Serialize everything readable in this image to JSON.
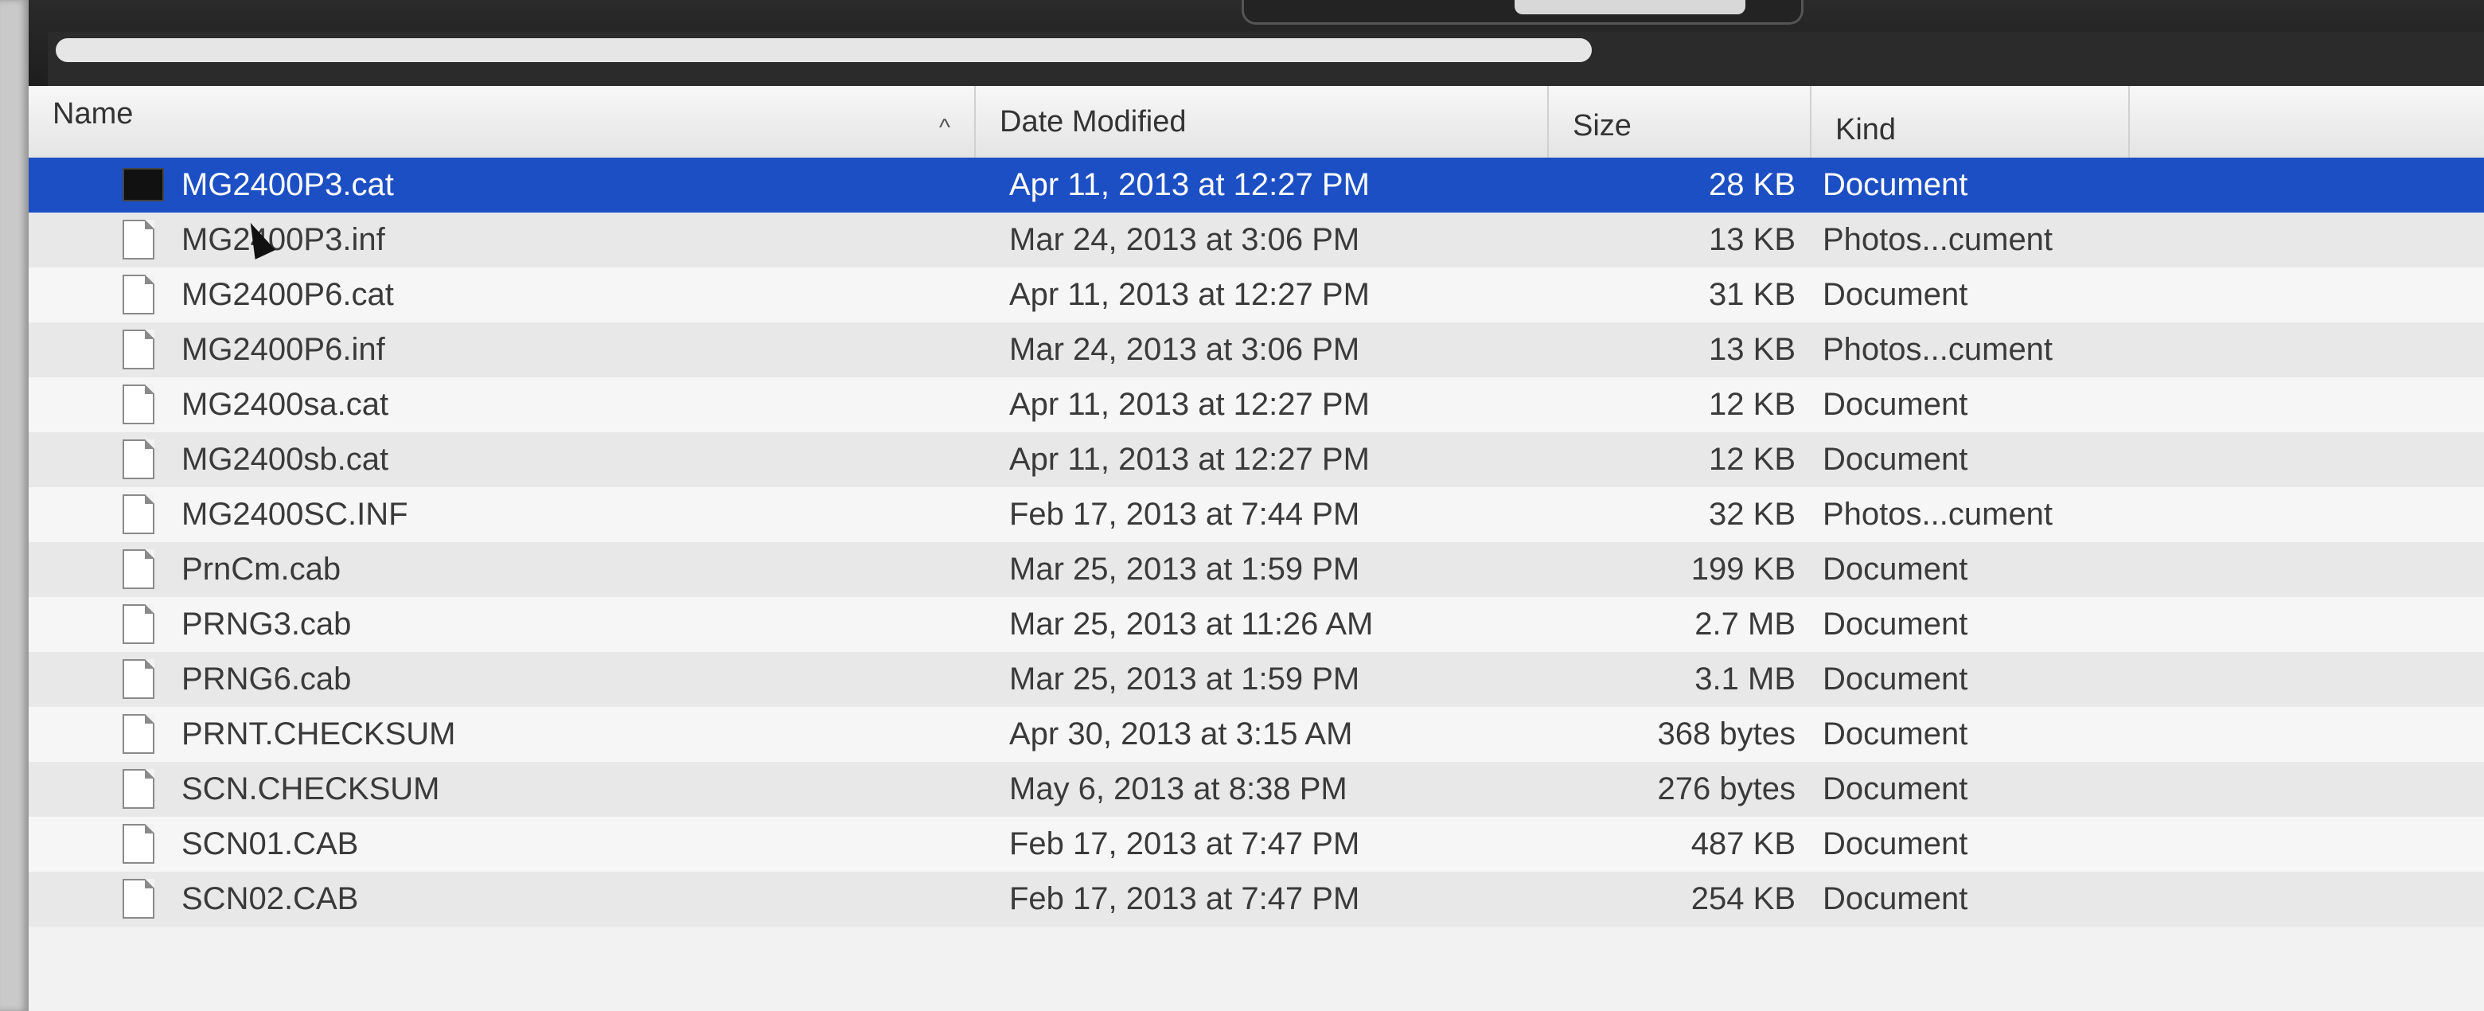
{
  "columns": {
    "name": "Name",
    "date": "Date Modified",
    "size": "Size",
    "kind": "Kind"
  },
  "sort": {
    "column": "name",
    "direction": "ascending",
    "icon": "chevron-up-icon"
  },
  "selected_index": 0,
  "files": [
    {
      "name": "MG2400P3.cat",
      "date": "Apr 11, 2013 at 12:27 PM",
      "size": "28 KB",
      "kind": "Document",
      "icon": "executable-icon"
    },
    {
      "name": "MG2400P3.inf",
      "date": "Mar 24, 2013 at 3:06 PM",
      "size": "13 KB",
      "kind": "Photos...cument",
      "icon": "document-icon"
    },
    {
      "name": "MG2400P6.cat",
      "date": "Apr 11, 2013 at 12:27 PM",
      "size": "31 KB",
      "kind": "Document",
      "icon": "document-icon"
    },
    {
      "name": "MG2400P6.inf",
      "date": "Mar 24, 2013 at 3:06 PM",
      "size": "13 KB",
      "kind": "Photos...cument",
      "icon": "document-icon"
    },
    {
      "name": "MG2400sa.cat",
      "date": "Apr 11, 2013 at 12:27 PM",
      "size": "12 KB",
      "kind": "Document",
      "icon": "document-icon"
    },
    {
      "name": "MG2400sb.cat",
      "date": "Apr 11, 2013 at 12:27 PM",
      "size": "12 KB",
      "kind": "Document",
      "icon": "document-icon"
    },
    {
      "name": "MG2400SC.INF",
      "date": "Feb 17, 2013 at 7:44 PM",
      "size": "32 KB",
      "kind": "Photos...cument",
      "icon": "document-icon"
    },
    {
      "name": "PrnCm.cab",
      "date": "Mar 25, 2013 at 1:59 PM",
      "size": "199 KB",
      "kind": "Document",
      "icon": "document-icon"
    },
    {
      "name": "PRNG3.cab",
      "date": "Mar 25, 2013 at 11:26 AM",
      "size": "2.7 MB",
      "kind": "Document",
      "icon": "document-icon"
    },
    {
      "name": "PRNG6.cab",
      "date": "Mar 25, 2013 at 1:59 PM",
      "size": "3.1 MB",
      "kind": "Document",
      "icon": "document-icon"
    },
    {
      "name": "PRNT.CHECKSUM",
      "date": "Apr 30, 2013 at 3:15 AM",
      "size": "368 bytes",
      "kind": "Document",
      "icon": "document-icon"
    },
    {
      "name": "SCN.CHECKSUM",
      "date": "May 6, 2013 at 8:38 PM",
      "size": "276 bytes",
      "kind": "Document",
      "icon": "document-icon"
    },
    {
      "name": "SCN01.CAB",
      "date": "Feb 17, 2013 at 7:47 PM",
      "size": "487 KB",
      "kind": "Document",
      "icon": "document-icon"
    },
    {
      "name": "SCN02.CAB",
      "date": "Feb 17, 2013 at 7:47 PM",
      "size": "254 KB",
      "kind": "Document",
      "icon": "document-icon"
    }
  ],
  "colors": {
    "selection": "#1d4fc4",
    "row_alt": "#e8e8e8",
    "row": "#f6f6f6",
    "text": "#3a3a3a"
  }
}
